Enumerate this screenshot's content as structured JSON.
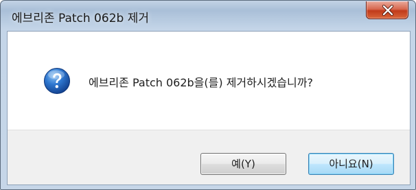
{
  "window": {
    "title": "에브리존 Patch 062b 제거",
    "close_icon": "close-icon"
  },
  "dialog": {
    "icon": "question-icon",
    "message": "에브리존 Patch 062b을(를) 제거하시겠습니까?"
  },
  "buttons": {
    "yes_label": "예(Y)",
    "no_label": "아니요(N)"
  },
  "colors": {
    "titlebar": "#b5c9df",
    "close_button": "#c13a1b",
    "question_icon": "#1f5fb8",
    "button_area": "#f0f0f0",
    "focused_button_border": "#3c7fb1"
  }
}
